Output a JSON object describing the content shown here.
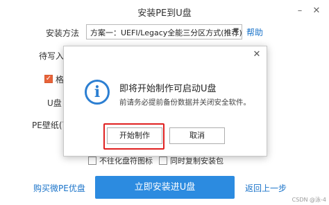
{
  "window": {
    "title": "安装PE到U盘",
    "minimize_glyph": "–",
    "close_glyph": "✕"
  },
  "form": {
    "install_method_label": "安装方法",
    "install_method_value": "方案一：UEFI/Legacy全能三分区方式(推荐)",
    "help_label": "帮助",
    "pending_write_label": "待写入",
    "format_label": "格",
    "udisk_label": "U盘",
    "pe_wallpaper_label": "PE壁纸(可",
    "no_format_label": "不往化盘符图标",
    "copy_image_label": "同时复制安装包"
  },
  "dialog": {
    "title": "即将开始制作可启动U盘",
    "message": "前请务必提前备份数据并关闭安全软件。",
    "start_label": "开始制作",
    "cancel_label": "取消",
    "close_glyph": "✕",
    "icon": "info-icon",
    "highlight_color": "#e02020"
  },
  "footer": {
    "buy_label": "购买微PE优盘",
    "install_label": "立即安装进U盘",
    "back_label": "返回上一步",
    "watermark": "CSDN @泳-4"
  },
  "colors": {
    "accent": "#2c8be0",
    "link": "#1a73c9",
    "checkbox_on": "#e8633a"
  }
}
